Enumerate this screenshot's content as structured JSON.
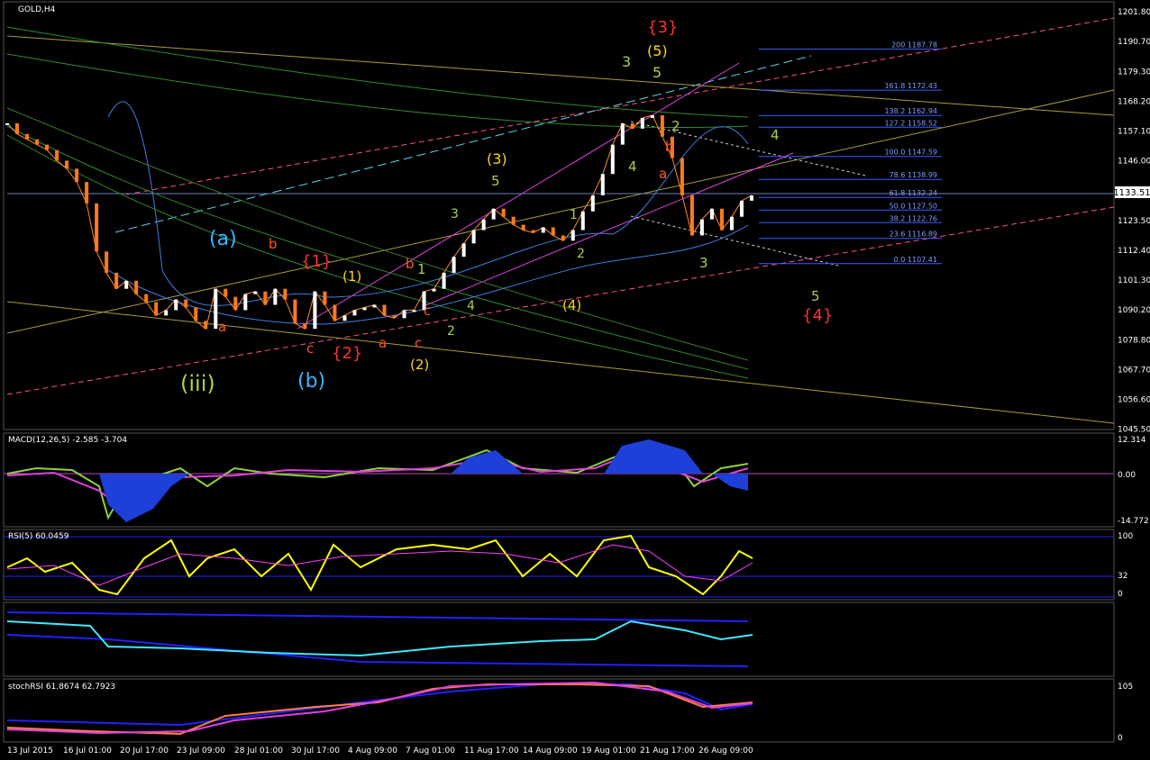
{
  "symbol": "GOLD,H4",
  "panels": {
    "macd": {
      "label": "MACD(12,26,5) -2.585 -3.704",
      "ticks": [
        "12.314",
        "0.00",
        "-14.772"
      ]
    },
    "rsi": {
      "label": "RSI(5) 60.0459",
      "ticks": [
        "100",
        "32",
        "0"
      ]
    },
    "stochrsi": {
      "label": "stochRSI 61.8674 62.7923",
      "ticks": [
        "105",
        "0"
      ]
    }
  },
  "current_price": "1133.51",
  "fib_levels": [
    {
      "label": "200 1187.78"
    },
    {
      "label": "161.8 1172.43"
    },
    {
      "label": "138.2 1162.94"
    },
    {
      "label": "127.2 1158.52"
    },
    {
      "label": "100.0 1147.59"
    },
    {
      "label": "78.6 1138.99"
    },
    {
      "label": "61.8 1132.24"
    },
    {
      "label": "50.0 1127.50"
    },
    {
      "label": "38.2 1122.76"
    },
    {
      "label": "23.6 1116.89"
    },
    {
      "label": "0.0 1107.41"
    }
  ],
  "wave_labels": [
    {
      "text": "{3}"
    },
    {
      "text": "(5)"
    },
    {
      "text": "3"
    },
    {
      "text": "5"
    },
    {
      "text": "2"
    },
    {
      "text": "4"
    },
    {
      "text": "a"
    },
    {
      "text": "b"
    },
    {
      "text": "(3)"
    },
    {
      "text": "5"
    },
    {
      "text": "3"
    },
    {
      "text": "1"
    },
    {
      "text": "2"
    },
    {
      "text": "(a)"
    },
    {
      "text": "b"
    },
    {
      "text": "{1}"
    },
    {
      "text": "(1)"
    },
    {
      "text": "b"
    },
    {
      "text": "1"
    },
    {
      "text": "4"
    },
    {
      "text": "(4)"
    },
    {
      "text": "a"
    },
    {
      "text": "c"
    },
    {
      "text": "(iii)"
    },
    {
      "text": "(b)"
    },
    {
      "text": "{2}"
    },
    {
      "text": "c"
    },
    {
      "text": "a"
    },
    {
      "text": "c"
    },
    {
      "text": "(2)"
    },
    {
      "text": "2"
    },
    {
      "text": "3"
    },
    {
      "text": "4"
    },
    {
      "text": "5"
    },
    {
      "text": "{4}"
    }
  ],
  "chart_data": {
    "type": "line",
    "title": "GOLD,H4",
    "xlabel": "",
    "ylabel": "",
    "ylim": [
      1045.95,
      1201.8
    ],
    "y_ticks": [
      "1201.80",
      "1190.70",
      "1179.30",
      "1168.20",
      "1157.10",
      "1146.00",
      "1134.90",
      "1123.50",
      "1112.40",
      "1101.30",
      "1090.20",
      "1078.80",
      "1067.70",
      "1056.60",
      "1045.50"
    ],
    "x_ticks": [
      "13 Jul 2015",
      "16 Jul 01:00",
      "20 Jul 17:00",
      "23 Jul 09:00",
      "28 Jul 01:00",
      "30 Jul 17:00",
      "4 Aug 09:00",
      "7 Aug 01:00",
      "11 Aug 17:00",
      "14 Aug 09:00",
      "19 Aug 01:00",
      "21 Aug 17:00",
      "26 Aug 09:00"
    ],
    "series": [
      {
        "values": [
          1160,
          1156,
          1154,
          1152,
          1150,
          1146,
          1143,
          1138,
          1130,
          1112,
          1104,
          1098,
          1101,
          1096,
          1093,
          1088,
          1090,
          1094,
          1091,
          1086,
          1083,
          1098,
          1095,
          1090,
          1096,
          1097,
          1092,
          1098,
          1094,
          1085,
          1083,
          1097,
          1092,
          1086,
          1088,
          1090,
          1091,
          1092,
          1088,
          1087,
          1090,
          1090,
          1097,
          1098,
          1104,
          1110,
          1115,
          1120,
          1124,
          1128,
          1125,
          1122,
          1120,
          1119,
          1121,
          1118,
          1116,
          1120,
          1127,
          1133,
          1141,
          1152,
          1160,
          1158,
          1162,
          1163,
          1155,
          1147,
          1133,
          1118,
          1124,
          1128,
          1120,
          1125,
          1131,
          1133
        ]
      }
    ]
  }
}
